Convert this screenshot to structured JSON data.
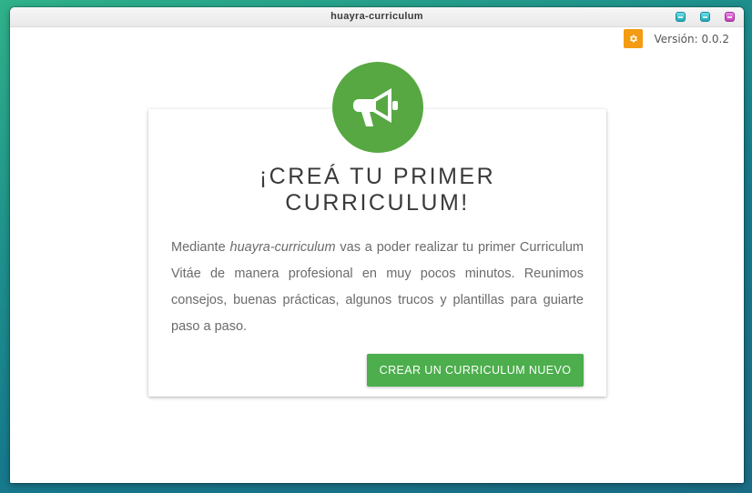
{
  "window": {
    "title": "huayra-curriculum"
  },
  "header": {
    "settings_icon": "gear-icon",
    "version": "Versión: 0.0.2",
    "settings_color": "#f39c12"
  },
  "welcome_card": {
    "icon": "megaphone-icon",
    "icon_background": "#57a843",
    "title_line1": "¡CREÁ TU PRIMER",
    "title_line2": "CURRICULUM!",
    "text_prefix": "Mediante ",
    "text_app_name": "huayra-curriculum",
    "text_rest": " vas a poder realizar tu primer Curriculum Vitáe de manera profesional en muy pocos minutos. Reunimos consejos, buenas prácticas, algunos trucos y plantillas para guiarte paso a paso.",
    "button_label": "CREAR UN CURRICULUM NUEVO",
    "button_color": "#4cae4c"
  }
}
